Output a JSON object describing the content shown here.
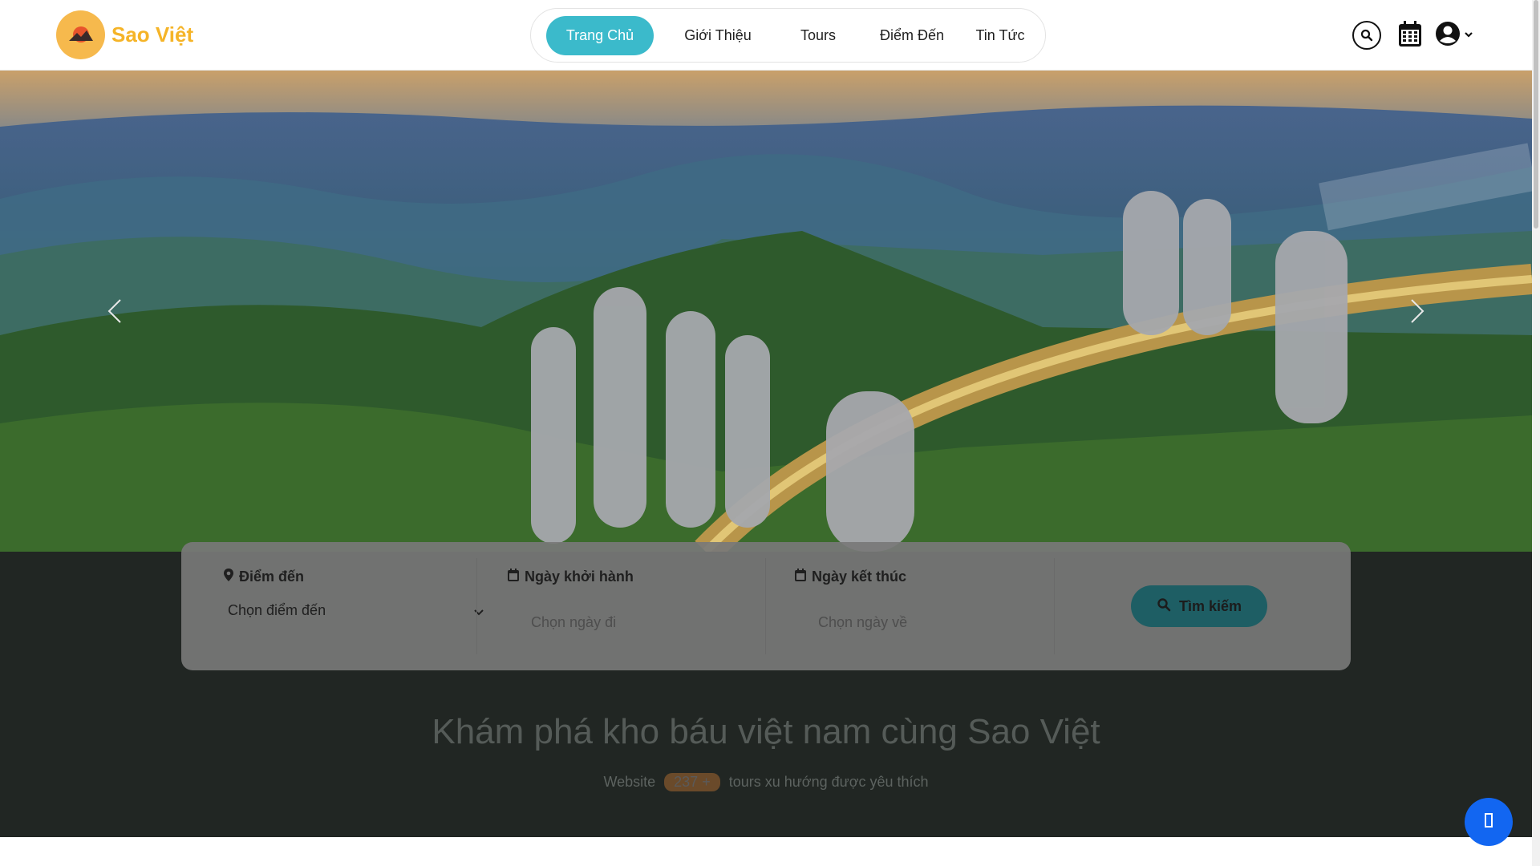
{
  "brand": {
    "name": "Sao Việt",
    "accent": "#f5b428"
  },
  "nav": {
    "items": [
      {
        "label": "Trang Chủ",
        "active": true
      },
      {
        "label": "Giới Thiệu",
        "active": false
      },
      {
        "label": "Tours",
        "active": false
      },
      {
        "label": "Điểm Đến",
        "active": false
      },
      {
        "label": "Tin Tức",
        "active": false
      }
    ],
    "active_color": "#3bbacb"
  },
  "header_icons": [
    "search-icon",
    "calendar-icon",
    "user-icon",
    "chevron-down-icon"
  ],
  "hero": {
    "prev_icon": "chevron-left-icon",
    "next_icon": "chevron-right-icon"
  },
  "search": {
    "destination_label": "Điểm đến",
    "destination_value": "Chọn điểm đến",
    "start_label": "Ngày khởi hành",
    "start_placeholder": "Chọn ngày đi",
    "end_label": "Ngày kết thúc",
    "end_placeholder": "Chọn ngày về",
    "button_label": "Tìm kiếm"
  },
  "intro": {
    "headline": "Khám phá kho báu việt nam cùng Sao Việt",
    "prefix": "Website",
    "count": "237 +",
    "suffix": "tours xu hướng được yêu thích"
  },
  "chat": {
    "icon": "chat-icon",
    "color": "#1266f1"
  }
}
